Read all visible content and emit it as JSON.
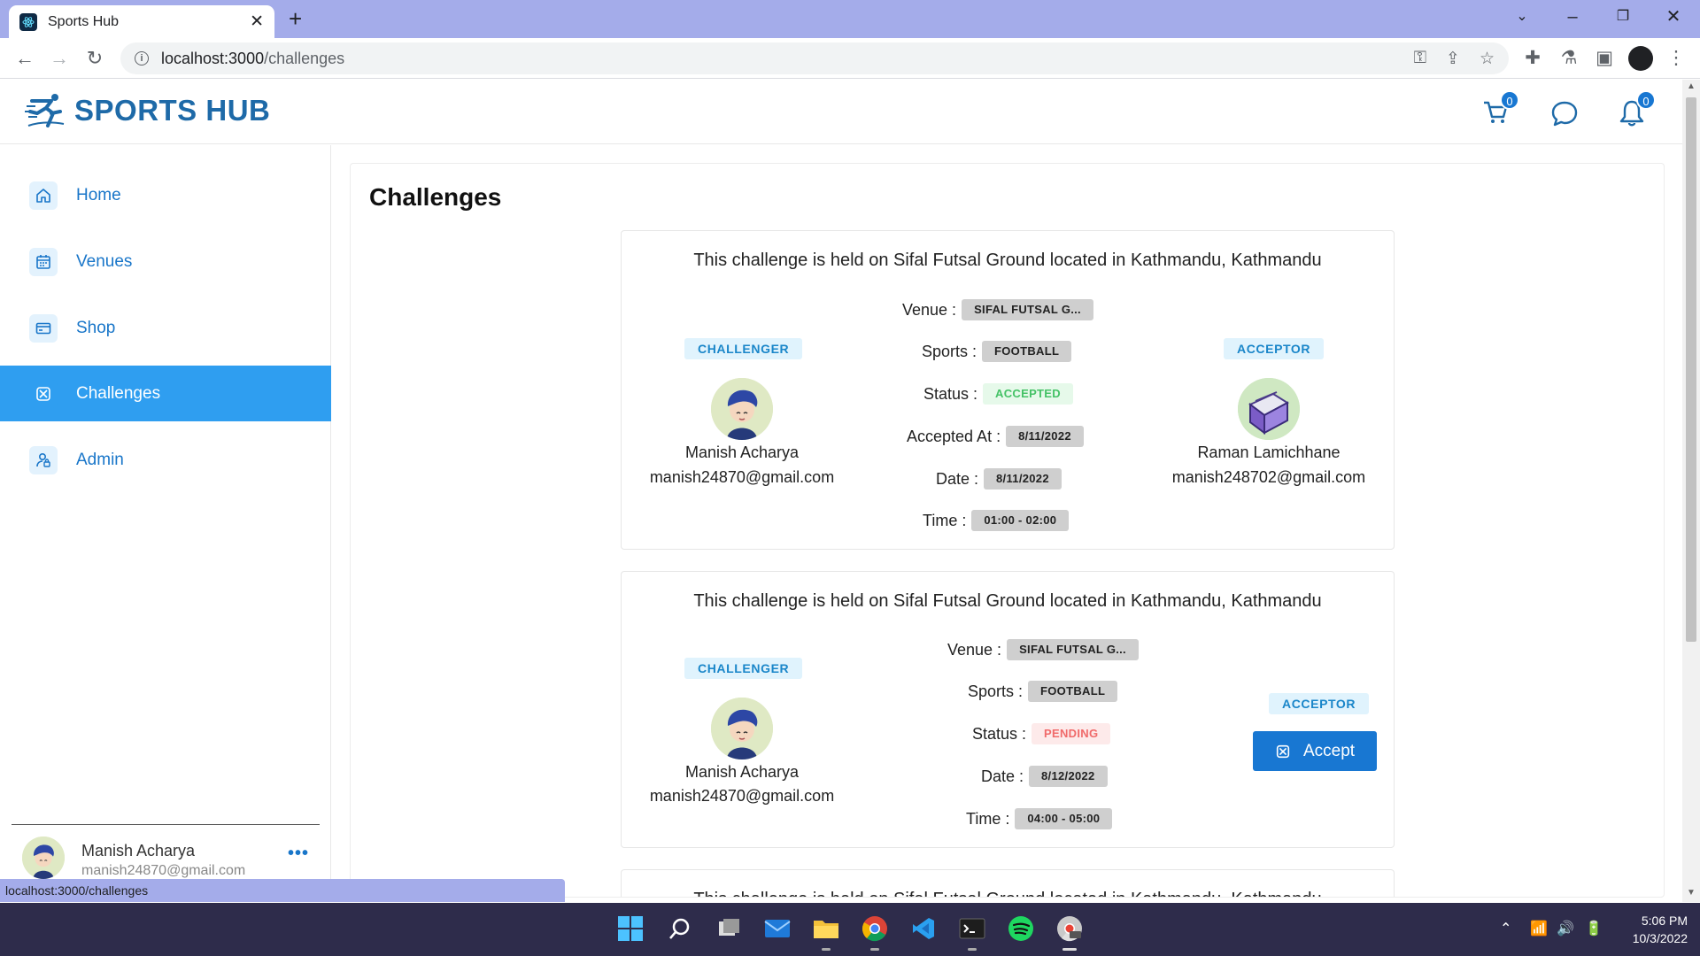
{
  "browser": {
    "tab_title": "Sports Hub",
    "url_host": "localhost:3000",
    "url_path": "/challenges",
    "status_url": "localhost:3000/challenges"
  },
  "header": {
    "brand": "SPORTS HUB",
    "cart_count": "0",
    "notification_count": "0"
  },
  "sidebar": {
    "items": [
      {
        "label": "Home",
        "icon": "home-icon"
      },
      {
        "label": "Venues",
        "icon": "calendar-icon"
      },
      {
        "label": "Shop",
        "icon": "card-icon"
      },
      {
        "label": "Challenges",
        "icon": "challenge-icon",
        "active": true
      },
      {
        "label": "Admin",
        "icon": "admin-icon"
      }
    ],
    "user": {
      "name": "Manish Acharya",
      "email": "manish24870@gmail.com"
    }
  },
  "page": {
    "title": "Challenges"
  },
  "challenges": [
    {
      "headline": "This challenge is held on Sifal Futsal Ground located in Kathmandu, Kathmandu",
      "challenger_label": "CHALLENGER",
      "acceptor_label": "ACCEPTOR",
      "challenger": {
        "name": "Manish Acharya",
        "email": "manish24870@gmail.com"
      },
      "acceptor": {
        "name": "Raman Lamichhane",
        "email": "manish248702@gmail.com"
      },
      "venue_key": "Venue :",
      "venue": "SIFAL FUTSAL G...",
      "sports_key": "Sports :",
      "sports": "FOOTBALL",
      "status_key": "Status :",
      "status": "ACCEPTED",
      "accepted_at_key": "Accepted At :",
      "accepted_at": "8/11/2022",
      "date_key": "Date :",
      "date": "8/11/2022",
      "time_key": "Time :",
      "time": "01:00 - 02:00"
    },
    {
      "headline": "This challenge is held on Sifal Futsal Ground located in Kathmandu, Kathmandu",
      "challenger_label": "CHALLENGER",
      "acceptor_label": "ACCEPTOR",
      "challenger": {
        "name": "Manish Acharya",
        "email": "manish24870@gmail.com"
      },
      "venue_key": "Venue :",
      "venue": "SIFAL FUTSAL G...",
      "sports_key": "Sports :",
      "sports": "FOOTBALL",
      "status_key": "Status :",
      "status": "PENDING",
      "date_key": "Date :",
      "date": "8/12/2022",
      "time_key": "Time :",
      "time": "04:00 - 05:00",
      "accept_button": "Accept"
    },
    {
      "headline": "This challenge is held on Sifal Futsal Ground located in Kathmandu, Kathmandu"
    }
  ],
  "taskbar": {
    "time": "5:06 PM",
    "date": "10/3/2022"
  },
  "colors": {
    "brand": "#1e6aa8",
    "active": "#2f9ef0",
    "accept": "#1877d2"
  }
}
